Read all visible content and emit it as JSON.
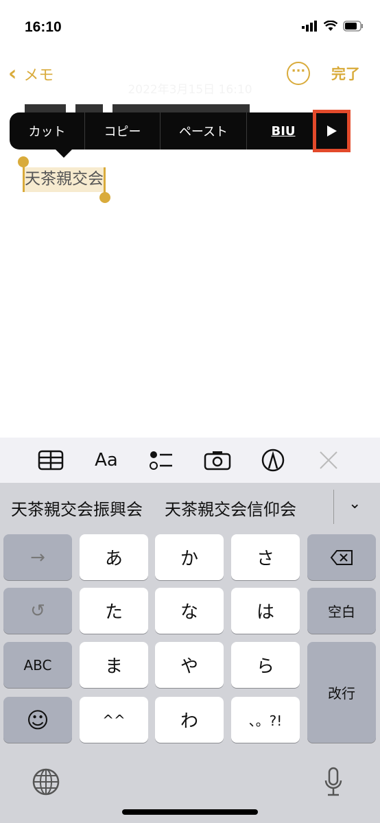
{
  "status_bar": {
    "time": "16:10",
    "icons": [
      "signal-icon",
      "wifi-icon",
      "battery-icon"
    ]
  },
  "nav": {
    "back_label": "メモ",
    "more_icon": "ellipsis-circle-icon",
    "done_label": "完了"
  },
  "note": {
    "date": "2022年3月15日 16:10",
    "selected_text": "天茶親交会"
  },
  "edit_menu": {
    "items": [
      "カット",
      "コピー",
      "ペースト",
      "BIU"
    ],
    "more_icon": "play-triangle-icon",
    "highlight_color": "#e34a2b"
  },
  "toolbar": {
    "icons": [
      "table-icon",
      "format-text-icon",
      "checklist-icon",
      "camera-icon",
      "markup-pen-icon",
      "close-icon"
    ],
    "format_label": "Aa"
  },
  "candidates": {
    "items": [
      "天茶親交会振興会",
      "天茶親交会信仰会"
    ],
    "expand_icon": "chevron-down-icon"
  },
  "keyboard": {
    "row1": [
      "→",
      "あ",
      "か",
      "さ",
      "⌫"
    ],
    "row2": [
      "↺",
      "た",
      "な",
      "は",
      "空白"
    ],
    "row3": [
      "ABC",
      "ま",
      "や",
      "ら",
      "改行"
    ],
    "row4": [
      "☺",
      "^^",
      "わ",
      "、。?!"
    ],
    "bottom_icons": [
      "globe-icon",
      "microphone-icon"
    ]
  },
  "colors": {
    "accent": "#d9ab3b",
    "selection_bg": "#f7ebcf",
    "keyboard_bg": "#d2d3d8"
  }
}
